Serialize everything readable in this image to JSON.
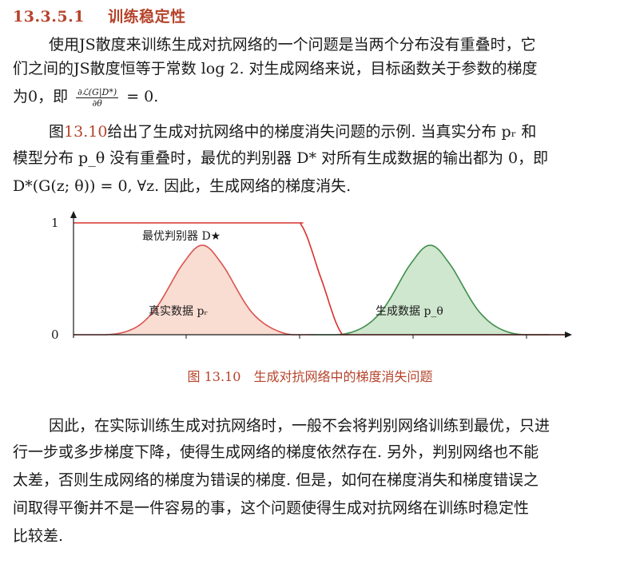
{
  "section": {
    "number": "13.3.5.1",
    "title": "训练稳定性"
  },
  "para1": {
    "line1": "使用JS散度来训练生成对抗网络的一个问题是当两个分布没有重叠时，它",
    "line2": "们之间的JS散度恒等于常数 log 2. 对生成网络来说，目标函数关于参数的梯度",
    "line3_prefix": "为0，即",
    "frac_num": "∂ℒ(G|D*)",
    "frac_den": "∂θ",
    "line3_suffix": "= 0."
  },
  "para2": {
    "line1_pre": "图",
    "line1_ref": "13.10",
    "line1_post": "给出了生成对抗网络中的梯度消失问题的示例. 当真实分布 pᵣ 和",
    "line2": "模型分布 p_θ 没有重叠时，最优的判别器 D* 对所有生成数据的输出都为 0，即",
    "line3": "D*(G(z; θ)) = 0, ∀z. 因此，生成网络的梯度消失."
  },
  "figure": {
    "caption_number": "图 13.10",
    "caption_text": "生成对抗网络中的梯度消失问题",
    "y_tick_1": "1",
    "y_tick_0": "0",
    "label_discriminator": "最优判别器 D★",
    "label_real": "真实数据 pᵣ",
    "label_model": "生成数据 p_θ",
    "colors": {
      "real_fill": "#f9dcd2",
      "real_line": "#d9534f",
      "model_fill": "#cfe6cf",
      "model_line": "#3f8f4a",
      "disc_line": "#d9302c",
      "caption": "#b5432b"
    }
  },
  "chart_data": {
    "type": "line",
    "title": "",
    "xlabel": "",
    "ylabel": "",
    "ylim": [
      0,
      1
    ],
    "yticks": [
      "0",
      "1"
    ],
    "series": [
      {
        "name": "最优判别器 D★",
        "x": [
          0,
          0.42,
          0.46,
          0.5,
          0.54,
          0.58,
          1.0
        ],
        "y": [
          1,
          1,
          0.98,
          0.5,
          0.02,
          0,
          0
        ]
      },
      {
        "name": "真实数据 pᵣ",
        "x": [
          0.0,
          0.1,
          0.16,
          0.22,
          0.26,
          0.3,
          0.36,
          0.42,
          0.48
        ],
        "y": [
          0,
          0.02,
          0.2,
          0.63,
          0.8,
          0.63,
          0.2,
          0.02,
          0
        ]
      },
      {
        "name": "生成数据 p_θ",
        "x": [
          0.48,
          0.56,
          0.62,
          0.68,
          0.72,
          0.76,
          0.82,
          0.88,
          0.96
        ],
        "y": [
          0,
          0.02,
          0.2,
          0.63,
          0.8,
          0.63,
          0.2,
          0.02,
          0
        ]
      }
    ]
  },
  "para3": {
    "line1": "因此，在实际训练生成对抗网络时，一般不会将判别网络训练到最优，只进",
    "line2": "行一步或多步梯度下降，使得生成网络的梯度依然存在. 另外，判别网络也不能",
    "line3": "太差，否则生成网络的梯度为错误的梯度. 但是，如何在梯度消失和梯度错误之",
    "line4": "间取得平衡并不是一件容易的事，这个问题使得生成对抗网络在训练时稳定性",
    "line5": "比较差."
  }
}
